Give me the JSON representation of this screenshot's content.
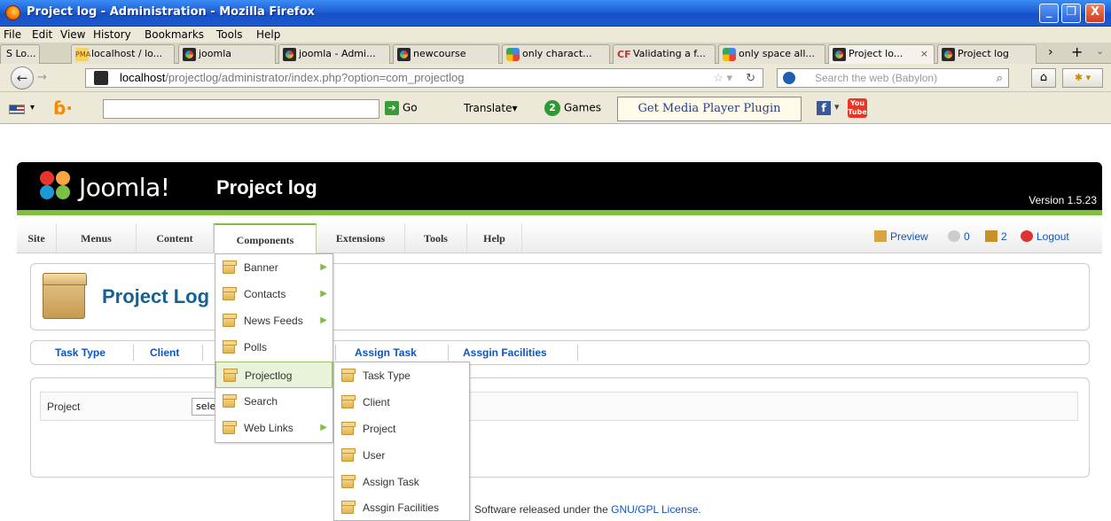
{
  "window": {
    "title": "Project log - Administration - Mozilla Firefox",
    "buttons": [
      "_",
      "❐",
      "X"
    ]
  },
  "browser_menu": [
    "File",
    "Edit",
    "View",
    "History",
    "Bookmarks",
    "Tools",
    "Help"
  ],
  "tabs": [
    {
      "label": "S Lo...",
      "icon": "back-chevron"
    },
    {
      "label": "localhost / lo...",
      "icon": "phpmyadmin-icon"
    },
    {
      "label": "joomla",
      "icon": "joomla-icon"
    },
    {
      "label": "joomla - Admi...",
      "icon": "joomla-icon"
    },
    {
      "label": "newcourse",
      "icon": "joomla-icon"
    },
    {
      "label": "only charact...",
      "icon": "google-icon"
    },
    {
      "label": "Validating a f...",
      "icon": "cf-icon"
    },
    {
      "label": "only space all...",
      "icon": "google-icon"
    },
    {
      "label": "Project lo...",
      "icon": "joomla-icon",
      "active": true
    },
    {
      "label": "Project log",
      "icon": "joomla-icon"
    }
  ],
  "nav": {
    "url_host": "localhost",
    "url_path": "/projectlog/administrator/index.php?option=com_projectlog",
    "search_placeholder": "Search the web (Babylon)"
  },
  "babylon": {
    "go": "Go",
    "translate": "Translate",
    "games": "Games",
    "media_plugin": "Get Media Player Plugin",
    "youtube": "You Tube"
  },
  "joomla": {
    "brand": "Joomla!",
    "site_name": "Project log",
    "version": "Version 1.5.23",
    "menu": [
      "Site",
      "Menus",
      "Content",
      "Components",
      "Extensions",
      "Tools",
      "Help"
    ],
    "status": {
      "preview": "Preview",
      "messages": "0",
      "users": "2",
      "logout": "Logout"
    },
    "page_title": "Project Log",
    "submenu": [
      "Task Type",
      "Client",
      "Assign Task",
      "Assgin Facilities"
    ],
    "filter_label": "Project",
    "filter_select": "select",
    "footer_text": "Software released under the",
    "footer_link": "GNU/GPL License."
  },
  "components_menu": [
    "Banner",
    "Contacts",
    "News Feeds",
    "Polls",
    "Projectlog",
    "Search",
    "Web Links"
  ],
  "projectlog_submenu": [
    "Task Type",
    "Client",
    "Project",
    "User",
    "Assign Task",
    "Assgin Facilities"
  ],
  "colors": {
    "accent_green": "#7fbf3d",
    "link_blue": "#0b55c4",
    "title_blue": "#146295"
  }
}
